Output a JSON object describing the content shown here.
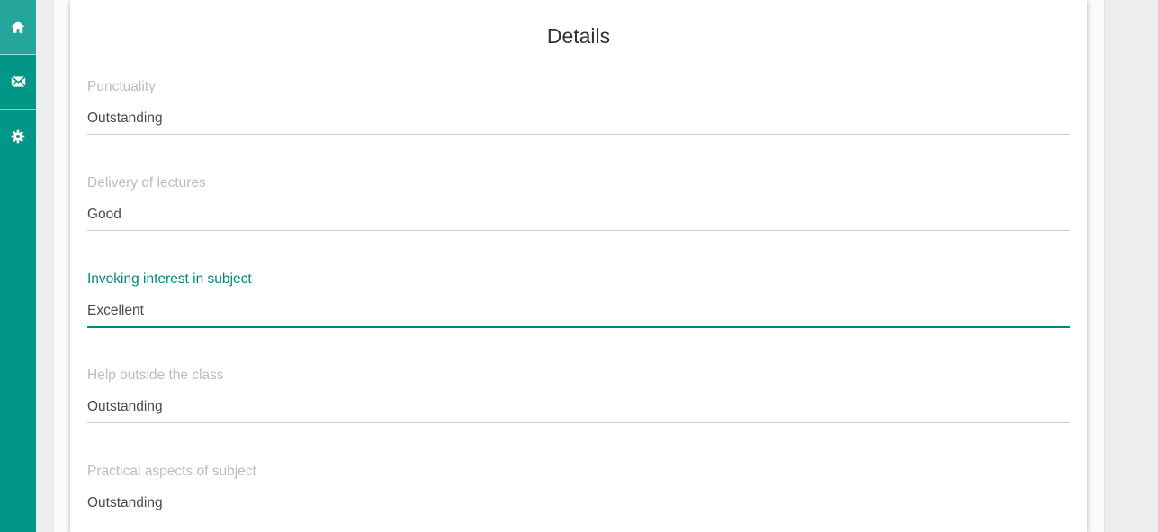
{
  "sidebar": {
    "items": [
      {
        "icon": "home-icon",
        "active": true
      },
      {
        "icon": "mail-icon",
        "active": false
      },
      {
        "icon": "gear-icon",
        "active": false
      }
    ]
  },
  "card": {
    "title": "Details",
    "fields": [
      {
        "label": "Punctuality",
        "value": "Outstanding"
      },
      {
        "label": "Delivery of lectures",
        "value": "Good"
      },
      {
        "label": "Invoking interest in subject",
        "value": "Excellent",
        "focused": true
      },
      {
        "label": "Help outside the class",
        "value": "Outstanding"
      },
      {
        "label": "Practical aspects of subject",
        "value": "Outstanding"
      }
    ]
  },
  "colors": {
    "sidebar": "#009688",
    "sidebar_active": "#26a69a",
    "accent": "#00897b",
    "label": "#bdbdbd",
    "value": "#4a4a4a"
  }
}
